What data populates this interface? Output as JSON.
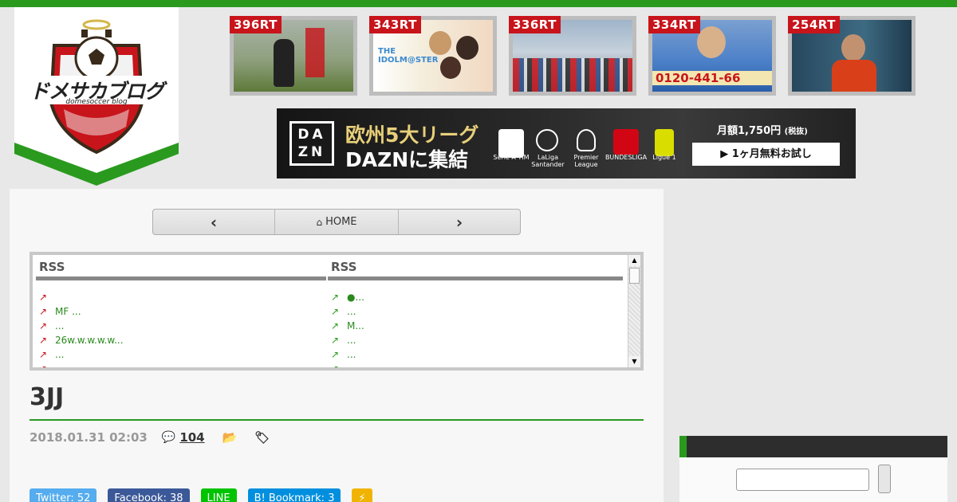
{
  "logo": {
    "text": "ドメサカブログ",
    "subtext": "domesoccer blog"
  },
  "thumbnails": [
    {
      "rt": "396RT"
    },
    {
      "rt": "343RT"
    },
    {
      "rt": "336RT"
    },
    {
      "rt": "334RT",
      "caption": "0120-441-66"
    },
    {
      "rt": "254RT"
    }
  ],
  "banner": {
    "logo_top": "DA",
    "logo_bottom": "ZN",
    "line1": "欧州5大リーグ",
    "line2": "DAZNに集結",
    "leagues": [
      "Serie A TIM",
      "LaLiga Santander",
      "Premier League",
      "BUNDESLIGA",
      "Ligue 1"
    ],
    "price": "月額1,750円",
    "price_note": "(税抜)",
    "trial": "▶ 1ヶ月無料お試し"
  },
  "pager": {
    "prev": "‹",
    "home": "HOME",
    "next": "›"
  },
  "rss": {
    "left": {
      "header": "RSS",
      "items": [
        "",
        "MF ...",
        "...",
        "26w.w.w.w.w...",
        "..."
      ]
    },
    "right": {
      "header": "RSS",
      "items": [
        "●...",
        "...",
        "M...",
        "...",
        "..."
      ]
    }
  },
  "post": {
    "title": "3JJ",
    "date": "2018.01.31 02:03",
    "comments": "104"
  },
  "shares": [
    {
      "label": "Twitter: 52",
      "color": "#55acee"
    },
    {
      "label": "Facebook: 38",
      "color": "#3b5998"
    },
    {
      "label": "LINE",
      "color": "#00c300"
    },
    {
      "label": "B! Bookmark: 3",
      "color": "#008fde"
    },
    {
      "label": "⚡",
      "color": "#f0b400"
    }
  ],
  "sidebar": {
    "search_placeholder": ""
  }
}
